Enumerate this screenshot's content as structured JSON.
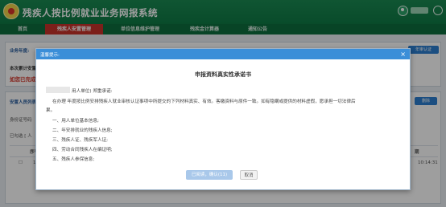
{
  "header": {
    "app_title": "残疾人按比例就业业务网报系统"
  },
  "nav": {
    "items": [
      {
        "label": "首页"
      },
      {
        "label": "残疾人安置管理"
      },
      {
        "label": "单位信息维护管理"
      },
      {
        "label": "残疾金计算器"
      },
      {
        "label": "通知公告"
      }
    ]
  },
  "background": {
    "year_label": "业务年度:",
    "cumulative_label": "本次累计安置",
    "warning_text": "如您已完成",
    "staff_section_label": "安置人员列表",
    "id_label": "身份证号码",
    "selected_label": "已勾选 [ 人",
    "col_seq": "序号",
    "row_one": "1",
    "right_btn_top": "年审认证",
    "right_btn_mid": "删除",
    "col_date": "期",
    "cell_time": "10:14:31"
  },
  "modal": {
    "title": "温馨提示:",
    "close_symbol": "×",
    "doc_title": "申报资料真实性承诺书",
    "salutation": "用人单位) 郑重承诺:",
    "paragraph_line1": "在办理 年度按比例安排残疾人就业审核认证事项中所提交的下列材料真实、有效。客缴资料与原件一致。如有隐瞒或提供的材料虚假，愿承担一切法律后",
    "paragraph_line2": "果。",
    "list": [
      "一、用人单位基本信息;",
      "二、年安排就业的残疾人信息;",
      "三、残疾人证、残疾军人证;",
      "四、劳动合同残疾人在编证明;",
      "五、残疾人参保信息;"
    ],
    "confirm_label": "已阅读，确认(11)",
    "cancel_label": "取消"
  }
}
